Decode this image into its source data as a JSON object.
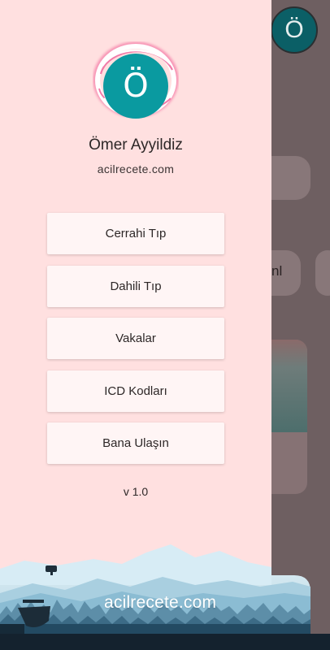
{
  "background_app": {
    "avatar_letter": "Ö",
    "partial_text": "nl"
  },
  "profile": {
    "avatar_letter": "Ö",
    "name": "Ömer Ayyildiz",
    "website": "acilrecete.com"
  },
  "menu": {
    "items": [
      {
        "label": "Cerrahi Tıp"
      },
      {
        "label": "Dahili Tıp"
      },
      {
        "label": "Vakalar"
      },
      {
        "label": "ICD Kodları"
      },
      {
        "label": "Bana Ulaşın"
      }
    ]
  },
  "version": "v 1.0",
  "footer": {
    "text": "acilrecete.com"
  },
  "colors": {
    "drawer_bg": "#ffe0e0",
    "avatar": "#0a9aa0",
    "avatar_glow": "#f04e8c",
    "menu_card": "#fff5f5",
    "scrim": "#6e5f61"
  }
}
